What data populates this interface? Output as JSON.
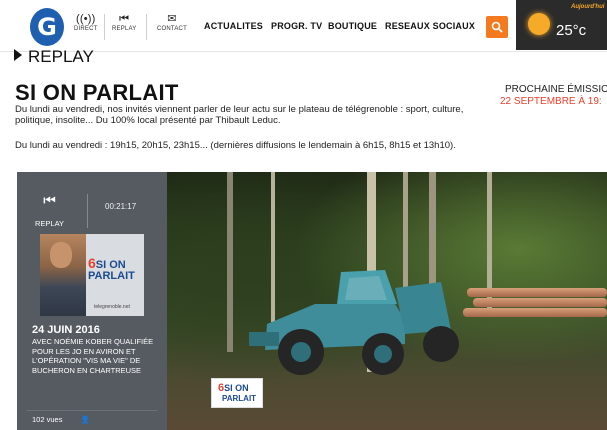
{
  "header": {
    "logo_letter": "G",
    "buttons": [
      {
        "label": "DIRECT",
        "icon": "broadcast-icon"
      },
      {
        "label": "REPLAY",
        "icon": "skip-back-icon"
      },
      {
        "label": "CONTACT",
        "icon": "envelope-icon"
      }
    ],
    "nav": [
      "ACTUALITES",
      "PROGR. TV",
      "BOUTIQUE",
      "RESEAUX SOCIAUX"
    ],
    "weather": {
      "today_label": "Aujourd'hui",
      "temperature": "25°c"
    },
    "colors": {
      "search_button": "#f47a20",
      "weather_bg": "#2b2b2b",
      "logo_blue": "#1f5fb0"
    }
  },
  "breadcrumb": "REPLAY",
  "show": {
    "title": "SI ON PARLAIT",
    "description": "Du lundi au vendredi, nos invités viennent parler de leur actu sur le plateau de télégrenoble : sport, culture, politique, insolite... Du 100% local présenté par Thibault Leduc.",
    "schedule": "Du lundi au vendredi : 19h15, 20h15, 23h15... (dernières diffusions le lendemain à 6h15, 8h15 et 13h10).",
    "next_label": "PROCHAINE ÉMISSIO",
    "next_date": "22 SEPTEMBRE À 19:"
  },
  "player": {
    "replay_label": "REPLAY",
    "duration": "00:21:17",
    "thumb_brand_line1": "SI ON",
    "thumb_brand_line2": "PARLAIT",
    "thumb_url": "telegrenoble.net",
    "episode_date": "24 JUIN 2016",
    "episode_caption": "AVEC NOÉMIE KOBER QUALIFIÉE POUR LES JO EN AVIRON ET L'OPÉRATION \"VIS MA VIE\" DE BUCHERON EN CHARTREUSE",
    "views": "102 vues"
  },
  "video": {
    "logo_line1": "SI ON",
    "logo_line2": "PARLAIT",
    "brand_digit": "6"
  }
}
